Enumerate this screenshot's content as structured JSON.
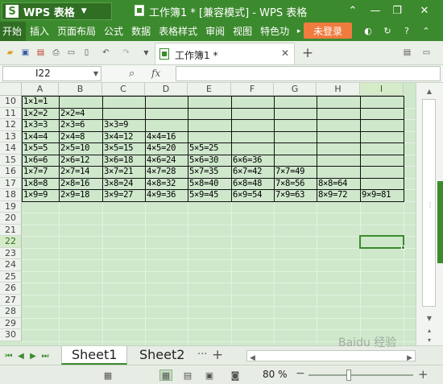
{
  "app": {
    "brand": "WPS 表格",
    "logo_letter": "S",
    "window_title": "工作簿1 * [兼容模式] - WPS 表格"
  },
  "menu": {
    "items": [
      "开始",
      "插入",
      "页面布局",
      "公式",
      "数据",
      "表格样式",
      "审阅",
      "视图",
      "特色功"
    ],
    "login_label": "未登录"
  },
  "document_tab": {
    "label": "工作簿1 *"
  },
  "formula_bar": {
    "name_box": "I22",
    "fx_label": "fx",
    "formula": ""
  },
  "columns": [
    "A",
    "B",
    "C",
    "D",
    "E",
    "F",
    "G",
    "H",
    "I"
  ],
  "rows": [
    "10",
    "11",
    "12",
    "13",
    "14",
    "15",
    "16",
    "17",
    "18",
    "19",
    "20",
    "21",
    "22",
    "23",
    "24",
    "25",
    "26",
    "27",
    "28",
    "29",
    "30"
  ],
  "cells": [
    [
      "1×1=1"
    ],
    [
      "1×2=2",
      "2×2=4"
    ],
    [
      "1×3=3",
      "2×3=6",
      "3×3=9"
    ],
    [
      "1×4=4",
      "2×4=8",
      "3×4=12",
      "4×4=16"
    ],
    [
      "1×5=5",
      "2×5=10",
      "3×5=15",
      "4×5=20",
      "5×5=25"
    ],
    [
      "1×6=6",
      "2×6=12",
      "3×6=18",
      "4×6=24",
      "5×6=30",
      "6×6=36"
    ],
    [
      "1×7=7",
      "2×7=14",
      "3×7=21",
      "4×7=28",
      "5×7=35",
      "6×7=42",
      "7×7=49"
    ],
    [
      "1×8=8",
      "2×8=16",
      "3×8=24",
      "4×8=32",
      "5×8=40",
      "6×8=48",
      "7×8=56",
      "8×8=64"
    ],
    [
      "1×9=9",
      "2×9=18",
      "3×9=27",
      "4×9=36",
      "5×9=45",
      "6×9=54",
      "7×9=63",
      "8×9=72",
      "9×9=81"
    ]
  ],
  "selected_cell": {
    "column": "I",
    "row": "22"
  },
  "sheets": {
    "tabs": [
      "Sheet1",
      "Sheet2"
    ],
    "active": "Sheet1",
    "more": "···",
    "add": "+"
  },
  "status": {
    "zoom": "80 %"
  },
  "watermark": "Baidu 经验",
  "colors": {
    "accent": "#3c8a2e",
    "grid_fill": "#cfe8cc",
    "login": "#f07b3f"
  }
}
